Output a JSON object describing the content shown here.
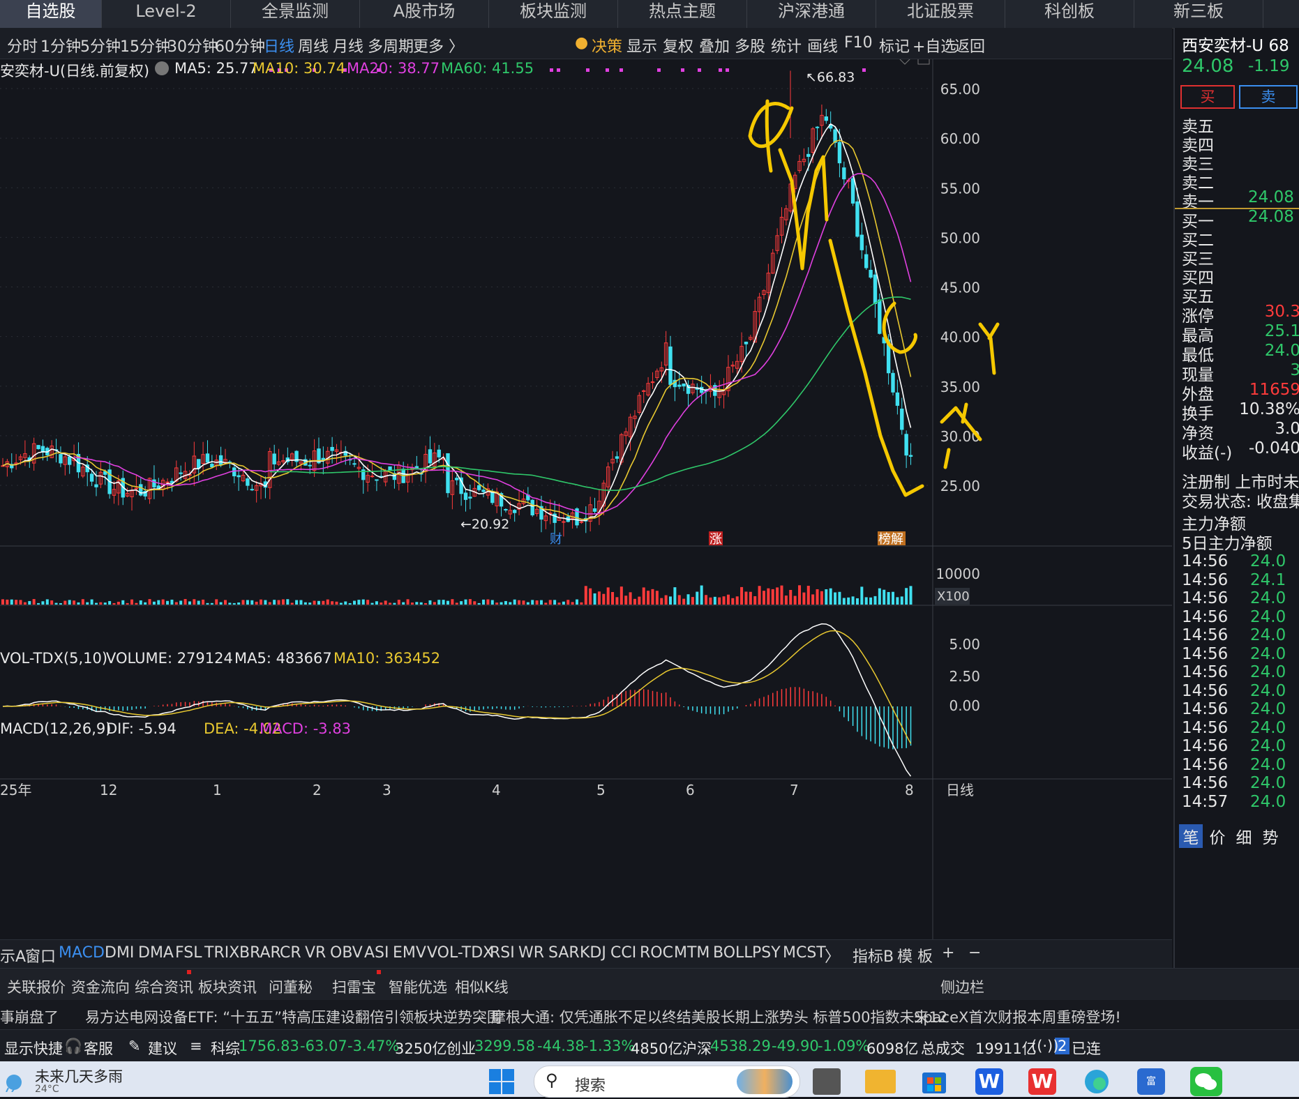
{
  "top_tabs": [
    "自选股",
    "Level-2",
    "全景监测",
    "A股市场",
    "板块监测",
    "热点主题",
    "沪深港通",
    "北证股票",
    "科创板",
    "新三板"
  ],
  "periods": [
    "分时",
    "1分钟",
    "5分钟",
    "15分钟",
    "30分钟",
    "60分钟",
    "日线",
    "周线",
    "月线",
    "多周期",
    "更多 〉"
  ],
  "tools": [
    "决策",
    "显示",
    "复权",
    "叠加",
    "多股",
    "统计",
    "画线",
    "F10",
    "标记",
    "+自选",
    "返回"
  ],
  "main_header": {
    "title": "安奕材-U(日线.前复权)",
    "ma5": "MA5: 25.77",
    "ma10": "MA10: 30.74",
    "ma20": "MA20: 38.77",
    "ma60": "MA60: 41.55"
  },
  "price_axis": [
    "65.00",
    "60.00",
    "55.00",
    "50.00",
    "45.00",
    "40.00",
    "35.00",
    "30.00",
    "25.00"
  ],
  "annotations": {
    "high": "66.83",
    "low": "20.92",
    "badge_cai": "财",
    "badge_zhang": "涨",
    "badge_bang": "榜解"
  },
  "vol_header": {
    "title": "VOL-TDX(5,10)",
    "volume": "VOLUME: 279124",
    "ma5": "MA5: 483667",
    "ma10": "MA10: 363452"
  },
  "vol_axis": {
    "top": "10000",
    "unit": "X100"
  },
  "macd_header": {
    "title": "MACD(12,26,9)",
    "dif": "DIF: -5.94",
    "dea": "DEA: -4.02",
    "macd": "MACD: -3.83"
  },
  "macd_axis": [
    "5.00",
    "2.50",
    "0.00"
  ],
  "time_axis": [
    "25年",
    "12",
    "1",
    "2",
    "3",
    "4",
    "5",
    "6",
    "7",
    "8"
  ],
  "time_axis_right": "日线",
  "indicators": [
    "示A",
    "窗口",
    "MACD",
    "DMI",
    "DMA",
    "FSL",
    "TRIX",
    "BRAR",
    "CR",
    "VR",
    "OBV",
    "ASI",
    "EMV",
    "VOL-TDX",
    "RSI",
    "WR",
    "SAR",
    "KDJ",
    "CCI",
    "ROC",
    "MTM",
    "BOLL",
    "PSY",
    "MCST",
    "〉"
  ],
  "indicator_right": [
    "指标B",
    "模 板",
    "+",
    "−"
  ],
  "info_tabs": [
    "关联报价",
    "资金流向",
    "综合资讯",
    "板块资讯",
    "问董秘",
    "扫雷宝",
    "智能优选",
    "相似K线",
    "侧边栏"
  ],
  "right_panel": {
    "name": "西安奕材-U 68",
    "price": "24.08",
    "change": "-1.19",
    "buy": "买",
    "sell": "卖",
    "asks": [
      "卖五",
      "卖四",
      "卖三",
      "卖二",
      "卖一"
    ],
    "ask1_price": "24.08",
    "bids": [
      "买一",
      "买二",
      "买三",
      "买四",
      "买五"
    ],
    "bid1_price": "24.08",
    "stats": [
      {
        "k": "涨停",
        "v": "30.3"
      },
      {
        "k": "最高",
        "v": "25.1"
      },
      {
        "k": "最低",
        "v": "24.0"
      },
      {
        "k": "现量",
        "v": "3"
      },
      {
        "k": "外盘",
        "v": "11659"
      },
      {
        "k": "换手",
        "v": "10.38%"
      },
      {
        "k": "净资",
        "v": "3.0"
      },
      {
        "k": "收益(-)",
        "v": "-0.040"
      }
    ],
    "reg": "注册制 上市时未",
    "trade_status": "交易状态: 收盘集",
    "main_net": "主力净额",
    "main_net5": "5日主力净额",
    "ticks": [
      {
        "t": "14:56",
        "p": "24.0"
      },
      {
        "t": "14:56",
        "p": "24.1"
      },
      {
        "t": "14:56",
        "p": "24.0"
      },
      {
        "t": "14:56",
        "p": "24.0"
      },
      {
        "t": "14:56",
        "p": "24.0"
      },
      {
        "t": "14:56",
        "p": "24.0"
      },
      {
        "t": "14:56",
        "p": "24.0"
      },
      {
        "t": "14:56",
        "p": "24.0"
      },
      {
        "t": "14:56",
        "p": "24.0"
      },
      {
        "t": "14:56",
        "p": "24.0"
      },
      {
        "t": "14:56",
        "p": "24.0"
      },
      {
        "t": "14:56",
        "p": "24.0"
      },
      {
        "t": "14:56",
        "p": "24.0"
      },
      {
        "t": "14:57",
        "p": "24.0"
      }
    ],
    "bottom_tabs": [
      "笔",
      "价",
      "细",
      "势"
    ]
  },
  "news": [
    "事崩盘了",
    "易方达电网设备ETF: “十五五”特高压建设翻倍引领板块逆势突围",
    "摩根大通: 仅凭通胀不足以终结美股长期上涨势头 标普500指数未来12",
    "SpaceX首次财报本周重磅登场! "
  ],
  "status": {
    "quick": "显示快捷",
    "service": "客服",
    "suggest": "建议",
    "idx1_name": "科综",
    "idx1_val": "1756.83",
    "idx1_chg": "-63.07",
    "idx1_pct": "-3.47%",
    "idx1_amt": "3250亿",
    "idx2_name": "创业",
    "idx2_val": "3299.58",
    "idx2_chg": "-44.38",
    "idx2_pct": "-1.33%",
    "idx2_amt": "4850亿",
    "idx3_name": "沪深",
    "idx3_val": "4538.29",
    "idx3_chg": "-49.90",
    "idx3_pct": "-1.09%",
    "idx3_amt": "6098亿",
    "total_label": "总成交",
    "total": "19911亿",
    "conn": "已连",
    "conn_n": "2"
  },
  "taskbar": {
    "weather": "未来几天多雨",
    "temp": "24°C",
    "search": "搜索"
  },
  "colors": {
    "up": "#ff3b3b",
    "down": "#40e0f0",
    "ma5": "#ffffff",
    "ma10": "#e8c830",
    "ma20": "#e040e0",
    "ma60": "#2fc86a",
    "handwriting": "#f5c800"
  }
}
